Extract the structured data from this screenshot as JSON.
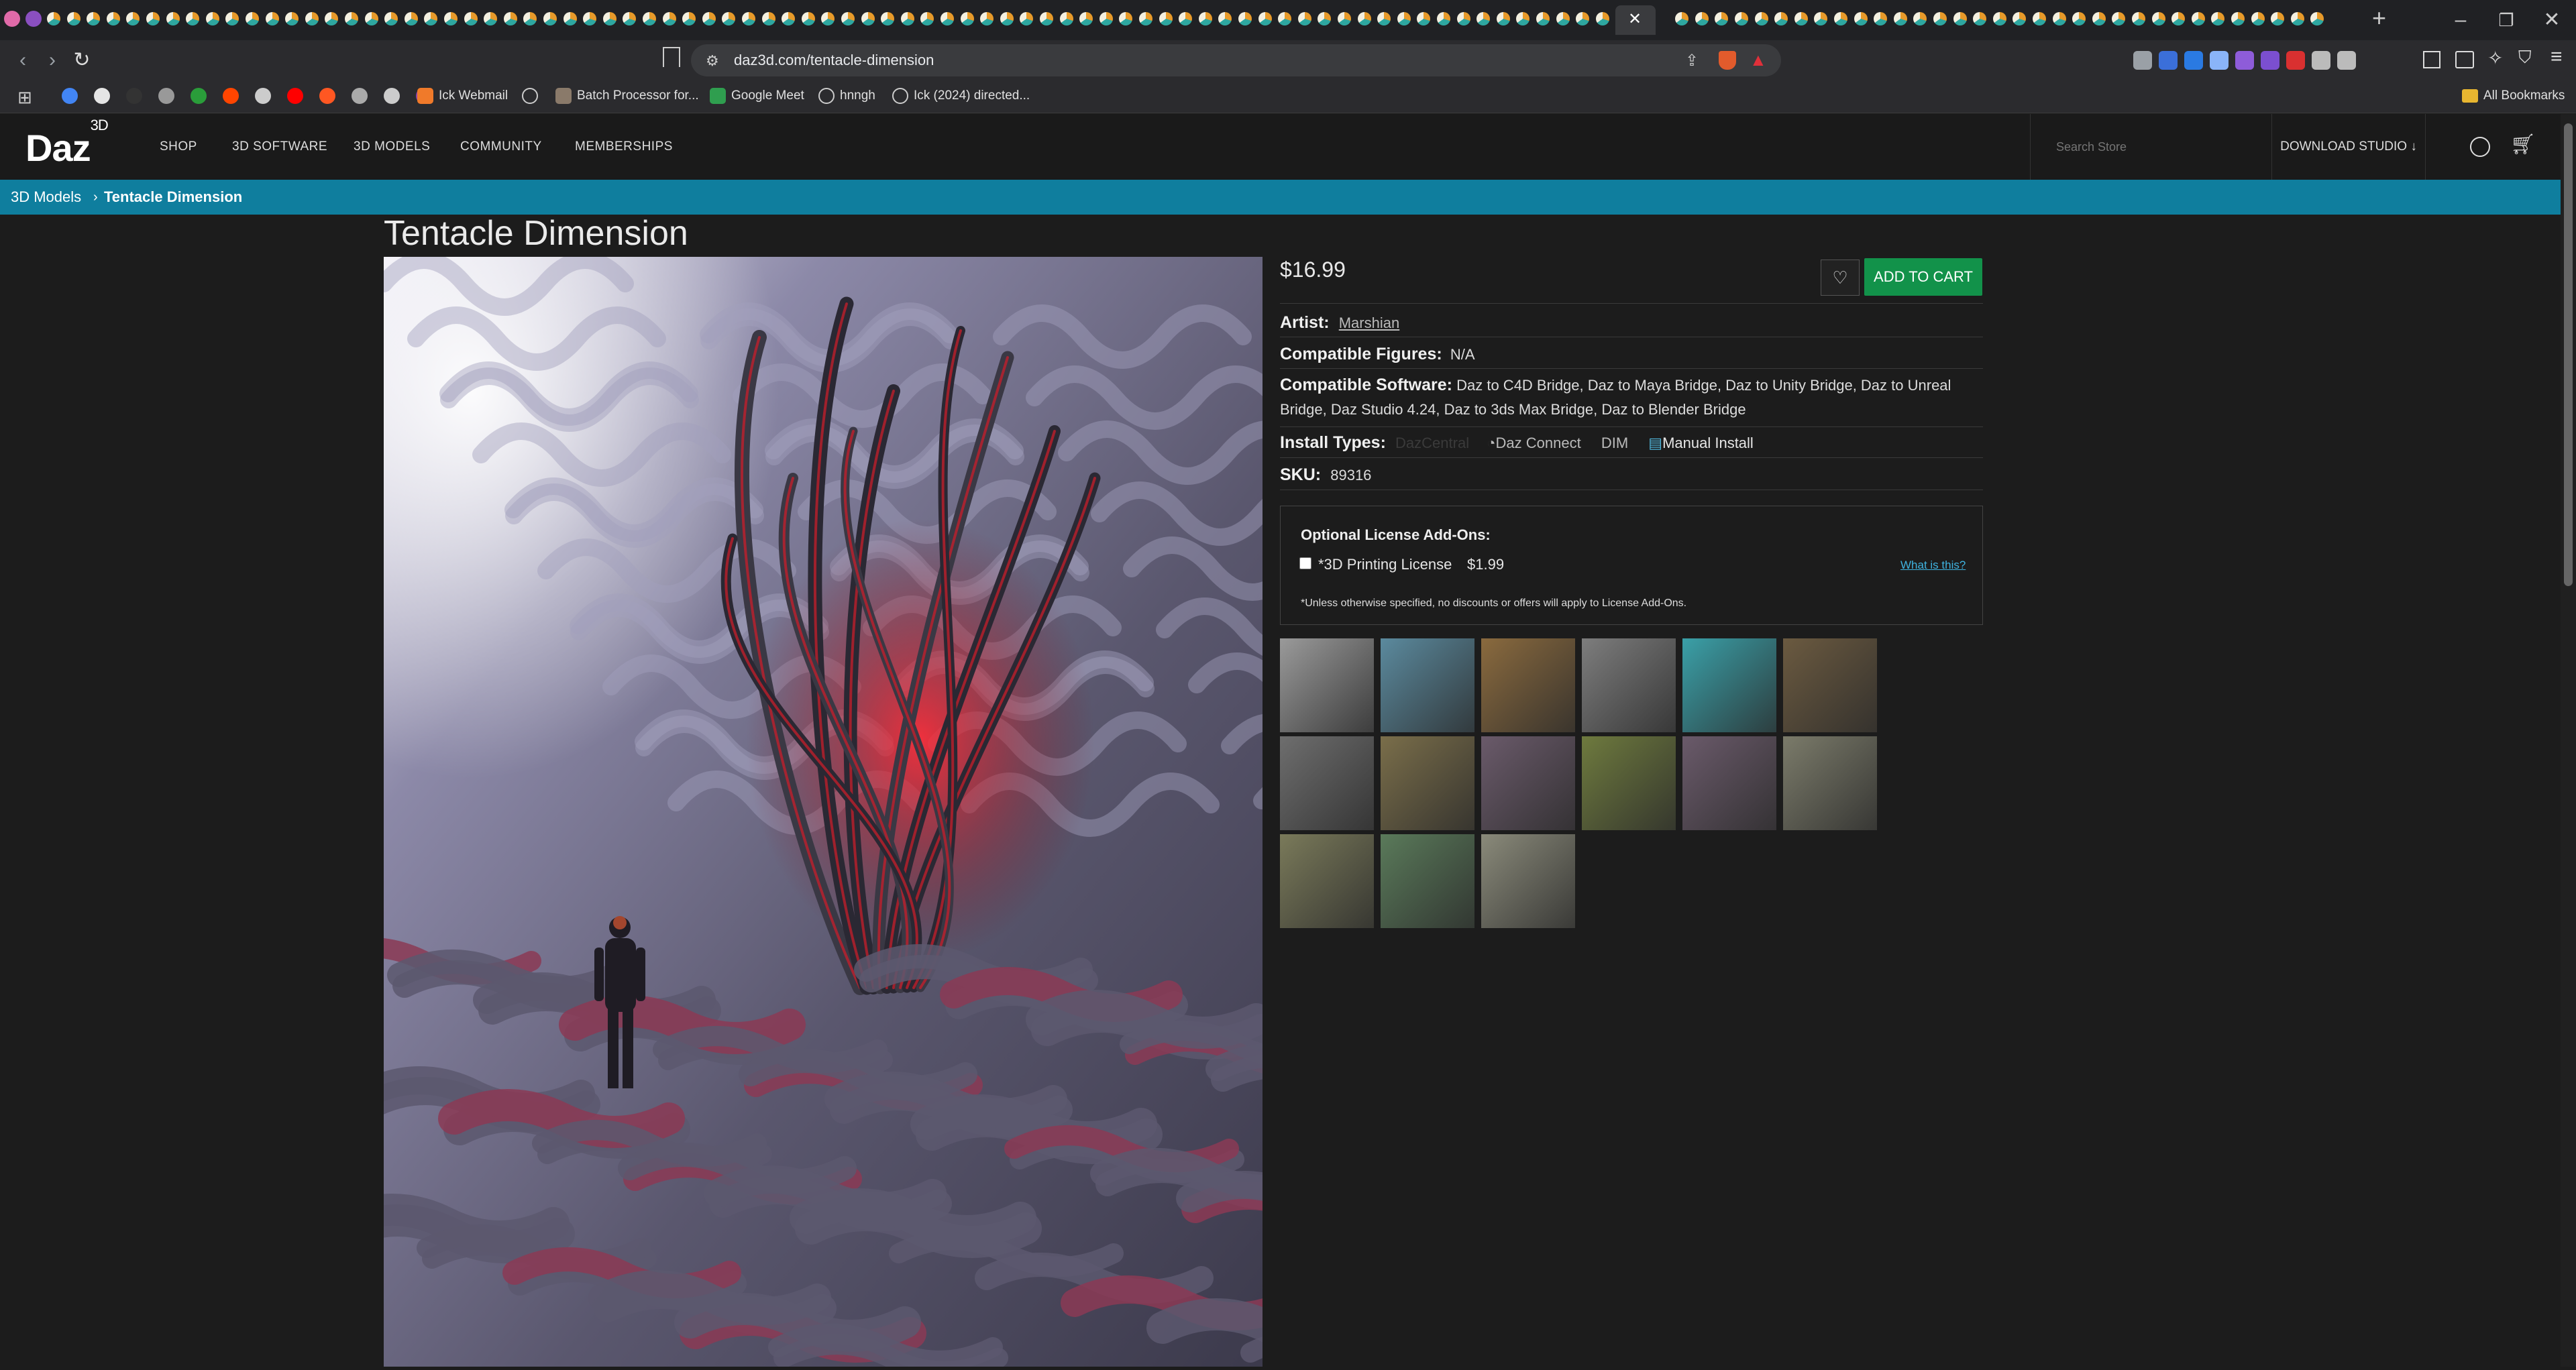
{
  "browser": {
    "active_tab_close": "✕",
    "url": "daz3d.com/tentacle-dimension",
    "bookmarks": [
      {
        "label": "Ick Webmail"
      },
      {
        "label": "Batch Processor for..."
      },
      {
        "label": "Google Meet"
      },
      {
        "label": "hnngh"
      },
      {
        "label": "Ick (2024) directed..."
      }
    ],
    "all_bookmarks": "All Bookmarks"
  },
  "site": {
    "logo": "Daz",
    "logo_sup": "3D",
    "nav": [
      "SHOP",
      "3D SOFTWARE",
      "3D MODELS",
      "COMMUNITY",
      "MEMBERSHIPS"
    ],
    "search_placeholder": "Search Store",
    "download_studio": "DOWNLOAD STUDIO"
  },
  "breadcrumb": {
    "parent": "3D Models",
    "separator": "›",
    "current": "Tentacle Dimension"
  },
  "product": {
    "title": "Tentacle Dimension",
    "price": "$16.99",
    "add_to_cart": "ADD TO CART",
    "artist_label": "Artist:",
    "artist": "Marshian",
    "figures_label": "Compatible Figures:",
    "figures": "N/A",
    "software_label": "Compatible Software:",
    "software": "Daz to C4D Bridge, Daz to Maya Bridge, Daz to Unity Bridge, Daz to Unreal Bridge, Daz Studio 4.24, Daz to 3ds Max Bridge, Daz to Blender Bridge",
    "install_label": "Install Types:",
    "install_types": [
      "DazCentral",
      "Daz Connect",
      "DIM",
      "Manual Install"
    ],
    "sku_label": "SKU:",
    "sku": "89316"
  },
  "license": {
    "heading": "Optional License Add-Ons:",
    "item_label": "*3D Printing License",
    "item_price": "$1.99",
    "what_link": "What is this?",
    "footnote": "*Unless otherwise specified, no discounts or offers will apply to License Add-Ons."
  },
  "colors": {
    "accent_teal": "#0f7e9e",
    "cart_green": "#12924a",
    "page_bg": "#1c1c1c"
  }
}
